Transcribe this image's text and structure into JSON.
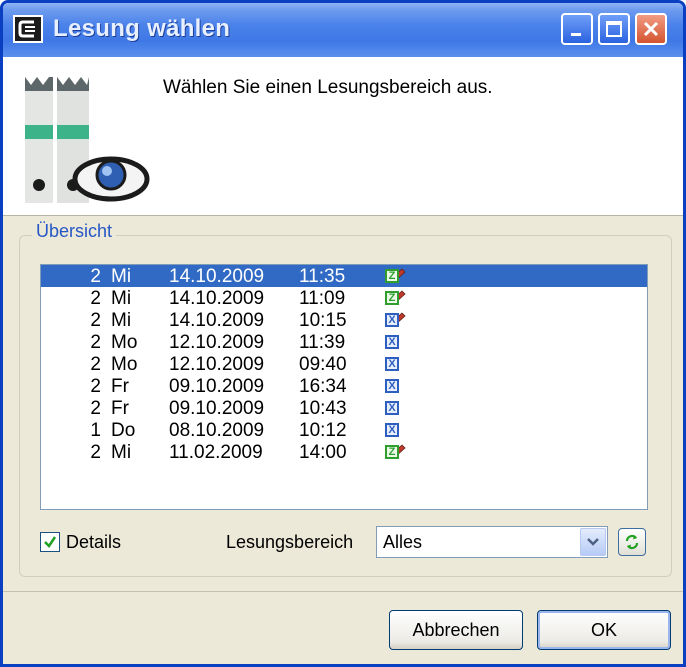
{
  "window": {
    "title": "Lesung wählen"
  },
  "header": {
    "text": "Wählen Sie einen Lesungsbereich aus."
  },
  "group": {
    "label": "Übersicht"
  },
  "list": {
    "rows": [
      {
        "n": "2",
        "day": "Mi",
        "date": "14.10.2009",
        "time": "11:35",
        "icons": [
          "z-icon",
          "pencil-icon"
        ],
        "selected": true
      },
      {
        "n": "2",
        "day": "Mi",
        "date": "14.10.2009",
        "time": "11:09",
        "icons": [
          "z-icon",
          "pencil-icon"
        ]
      },
      {
        "n": "2",
        "day": "Mi",
        "date": "14.10.2009",
        "time": "10:15",
        "icons": [
          "x-icon",
          "pencil-icon"
        ]
      },
      {
        "n": "2",
        "day": "Mo",
        "date": "12.10.2009",
        "time": "11:39",
        "icons": [
          "x-icon"
        ]
      },
      {
        "n": "2",
        "day": "Mo",
        "date": "12.10.2009",
        "time": "09:40",
        "icons": [
          "x-icon"
        ]
      },
      {
        "n": "2",
        "day": "Fr",
        "date": "09.10.2009",
        "time": "16:34",
        "icons": [
          "x-icon"
        ]
      },
      {
        "n": "2",
        "day": "Fr",
        "date": "09.10.2009",
        "time": "10:43",
        "icons": [
          "x-icon"
        ]
      },
      {
        "n": "1",
        "day": "Do",
        "date": "08.10.2009",
        "time": "10:12",
        "icons": [
          "x-icon"
        ]
      },
      {
        "n": "2",
        "day": "Mi",
        "date": "11.02.2009",
        "time": "14:00",
        "icons": [
          "z-icon",
          "pencil-icon"
        ]
      }
    ]
  },
  "details": {
    "label": "Details",
    "checked": true
  },
  "lesungsbereich": {
    "label": "Lesungsbereich",
    "value": "Alles"
  },
  "buttons": {
    "cancel": "Abbrechen",
    "ok": "OK"
  },
  "colors": {
    "titlebar": "#3f78e6",
    "selection": "#316ac5",
    "dialog_bg": "#ece9d8",
    "z_icon": "#2f9e2f",
    "x_icon": "#2e5fc0"
  }
}
